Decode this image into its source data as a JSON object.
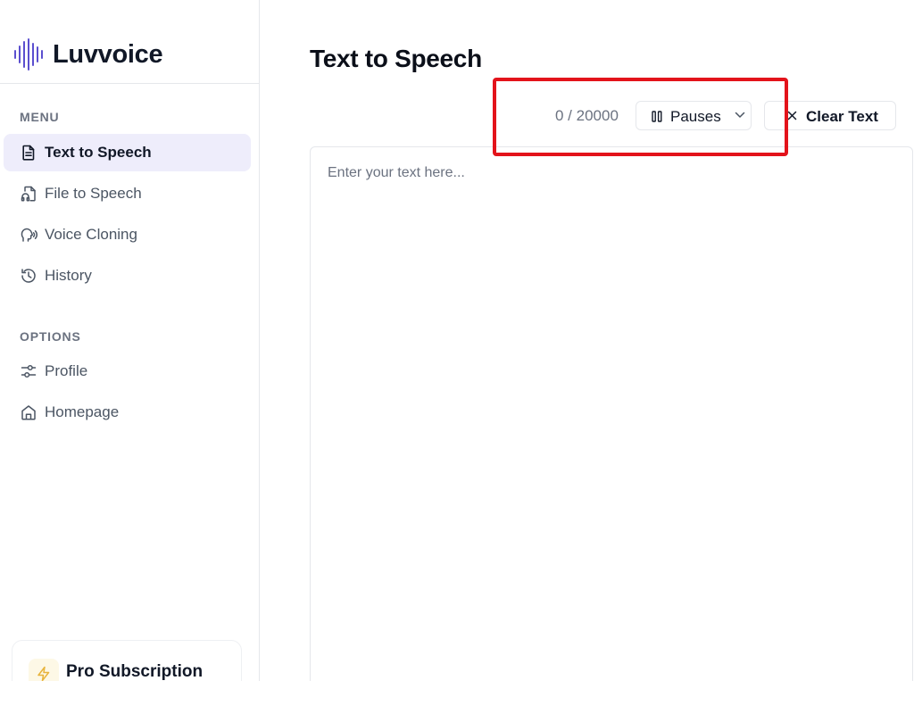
{
  "brand": {
    "name": "Luvvoice",
    "logo_icon": "sound-wave-icon",
    "accent_color": "#5b4fcf"
  },
  "sidebar": {
    "menu_label": "MENU",
    "menu_items": [
      {
        "label": "Text to Speech",
        "icon": "document-icon",
        "active": true
      },
      {
        "label": "File to Speech",
        "icon": "file-audio-icon",
        "active": false
      },
      {
        "label": "Voice Cloning",
        "icon": "voice-head-icon",
        "active": false
      },
      {
        "label": "History",
        "icon": "history-icon",
        "active": false
      }
    ],
    "options_label": "OPTIONS",
    "options_items": [
      {
        "label": "Profile",
        "icon": "sliders-icon"
      },
      {
        "label": "Homepage",
        "icon": "home-icon"
      }
    ],
    "pro": {
      "title": "Pro Subscription",
      "icon": "lightning-icon"
    }
  },
  "main": {
    "title": "Text to Speech",
    "char_count": "0 / 20000",
    "pauses_label": "Pauses",
    "clear_label": "Clear Text",
    "editor": {
      "placeholder": "Enter your text here...",
      "value": ""
    }
  },
  "colors": {
    "active_nav_bg": "#eeedfb",
    "highlight": "#e3131b",
    "pro_icon_bg": "#fdf8e6",
    "pro_icon": "#e8b43c"
  }
}
